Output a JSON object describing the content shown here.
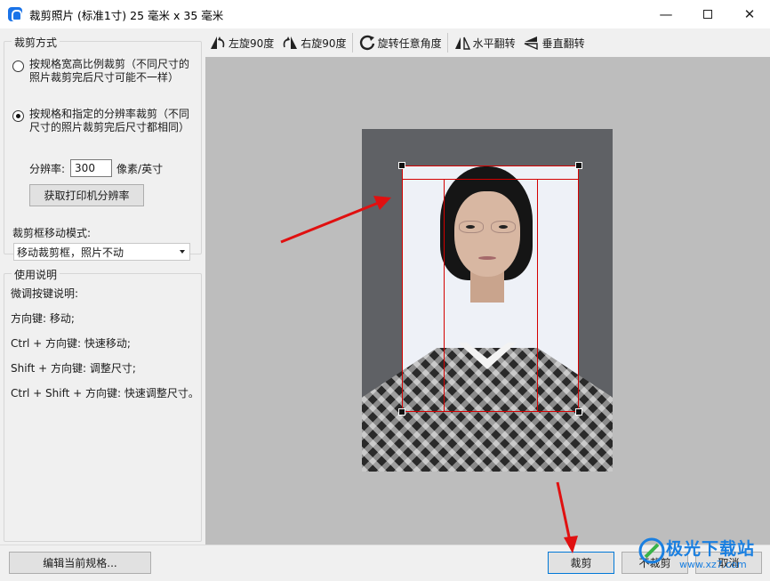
{
  "window": {
    "title": "裁剪照片 (标准1寸) 25 毫米 x 35 毫米",
    "minimize": "—",
    "close": "✕"
  },
  "crop_mode": {
    "legend": "裁剪方式",
    "option_ratio": "按规格宽高比例裁剪（不同尺寸的照片裁剪完后尺寸可能不一样）",
    "option_resolution": "按规格和指定的分辨率裁剪（不同尺寸的照片裁剪完后尺寸都相同）",
    "selected": "option_resolution",
    "resolution_label": "分辨率:",
    "resolution_value": "300",
    "resolution_unit": "像素/英寸",
    "get_printer_button": "获取打印机分辨率",
    "move_mode_label": "裁剪框移动模式:",
    "move_mode_value": "移动裁剪框，照片不动"
  },
  "help": {
    "legend": "使用说明",
    "lines": [
      "微调按键说明:",
      "方向键: 移动;",
      "Ctrl + 方向键: 快速移动;",
      "Shift + 方向键: 调整尺寸;",
      "Ctrl + Shift + 方向键: 快速调整尺寸。"
    ]
  },
  "toolbar": {
    "rotate_left": "左旋90度",
    "rotate_right": "右旋90度",
    "rotate_any": "旋转任意角度",
    "flip_horizontal": "水平翻转",
    "flip_vertical": "垂直翻转"
  },
  "bottom": {
    "edit_spec": "编辑当前规格...",
    "crop": "裁剪",
    "no_crop": "不裁剪",
    "cancel": "取消"
  },
  "watermark": {
    "text": "极光下载站",
    "url": "www.xz7.com"
  },
  "colors": {
    "crop_frame": "#d40000",
    "annotation_arrow": "#e01010",
    "accent": "#0078d7"
  }
}
